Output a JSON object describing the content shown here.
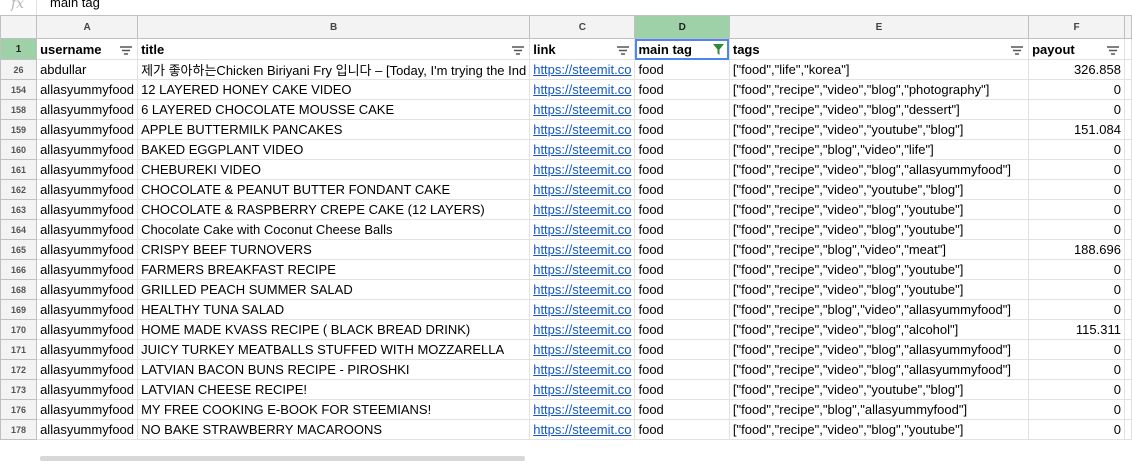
{
  "formula_bar": {
    "fx": "fx",
    "value": "main tag"
  },
  "columns": [
    "A",
    "B",
    "C",
    "D",
    "E",
    "F"
  ],
  "header": {
    "row": "1",
    "cells": [
      "username",
      "title",
      "link",
      "main tag",
      "tags",
      "payout"
    ]
  },
  "rows": [
    {
      "n": "26",
      "username": "abdullar",
      "title": "제가 좋아하는Chicken Biriyani Fry 입니다 – [Today, I'm trying the Ind",
      "link": "https://steemit.co",
      "main_tag": "food",
      "tags": "[\"food\",\"life\",\"korea\"]",
      "payout": "326.858"
    },
    {
      "n": "154",
      "username": "allasyummyfood",
      "title": "12 LAYERED HONEY CAKE VIDEO",
      "link": "https://steemit.co",
      "main_tag": "food",
      "tags": "[\"food\",\"recipe\",\"video\",\"blog\",\"photography\"]",
      "payout": "0"
    },
    {
      "n": "158",
      "username": "allasyummyfood",
      "title": "6 LAYERED CHOCOLATE MOUSSE CAKE",
      "link": "https://steemit.co",
      "main_tag": "food",
      "tags": "[\"food\",\"recipe\",\"video\",\"blog\",\"dessert\"]",
      "payout": "0"
    },
    {
      "n": "159",
      "username": "allasyummyfood",
      "title": "APPLE BUTTERMILK PANCAKES",
      "link": "https://steemit.co",
      "main_tag": "food",
      "tags": "[\"food\",\"recipe\",\"video\",\"youtube\",\"blog\"]",
      "payout": "151.084"
    },
    {
      "n": "160",
      "username": "allasyummyfood",
      "title": "BAKED EGGPLANT VIDEO",
      "link": "https://steemit.co",
      "main_tag": "food",
      "tags": "[\"food\",\"recipe\",\"blog\",\"video\",\"life\"]",
      "payout": "0"
    },
    {
      "n": "161",
      "username": "allasyummyfood",
      "title": "CHEBUREKI VIDEO",
      "link": "https://steemit.co",
      "main_tag": "food",
      "tags": "[\"food\",\"recipe\",\"video\",\"blog\",\"allasyummyfood\"]",
      "payout": "0"
    },
    {
      "n": "162",
      "username": "allasyummyfood",
      "title": "CHOCOLATE & PEANUT BUTTER FONDANT CAKE",
      "link": "https://steemit.co",
      "main_tag": "food",
      "tags": "[\"food\",\"recipe\",\"video\",\"youtube\",\"blog\"]",
      "payout": "0"
    },
    {
      "n": "163",
      "username": "allasyummyfood",
      "title": "CHOCOLATE & RASPBERRY CREPE CAKE (12 LAYERS)",
      "link": "https://steemit.co",
      "main_tag": "food",
      "tags": "[\"food\",\"recipe\",\"video\",\"blog\",\"youtube\"]",
      "payout": "0"
    },
    {
      "n": "164",
      "username": "allasyummyfood",
      "title": "Chocolate Cake with Coconut Cheese Balls",
      "link": "https://steemit.co",
      "main_tag": "food",
      "tags": "[\"food\",\"recipe\",\"video\",\"blog\",\"youtube\"]",
      "payout": "0"
    },
    {
      "n": "165",
      "username": "allasyummyfood",
      "title": "CRISPY BEEF TURNOVERS",
      "link": "https://steemit.co",
      "main_tag": "food",
      "tags": "[\"food\",\"recipe\",\"blog\",\"video\",\"meat\"]",
      "payout": "188.696"
    },
    {
      "n": "166",
      "username": "allasyummyfood",
      "title": "FARMERS BREAKFAST RECIPE",
      "link": "https://steemit.co",
      "main_tag": "food",
      "tags": "[\"food\",\"recipe\",\"video\",\"blog\",\"youtube\"]",
      "payout": "0"
    },
    {
      "n": "168",
      "username": "allasyummyfood",
      "title": "GRILLED PEACH SUMMER SALAD",
      "link": "https://steemit.co",
      "main_tag": "food",
      "tags": "[\"food\",\"recipe\",\"video\",\"blog\",\"youtube\"]",
      "payout": "0"
    },
    {
      "n": "169",
      "username": "allasyummyfood",
      "title": "HEALTHY TUNA SALAD",
      "link": "https://steemit.co",
      "main_tag": "food",
      "tags": "[\"food\",\"recipe\",\"blog\",\"video\",\"allasyummyfood\"]",
      "payout": "0"
    },
    {
      "n": "170",
      "username": "allasyummyfood",
      "title": "HOME MADE KVASS RECIPE ( BLACK BREAD DRINK)",
      "link": "https://steemit.co",
      "main_tag": "food",
      "tags": "[\"food\",\"recipe\",\"video\",\"blog\",\"alcohol\"]",
      "payout": "115.311"
    },
    {
      "n": "171",
      "username": "allasyummyfood",
      "title": "JUICY TURKEY MEATBALLS STUFFED WITH MOZZARELLA",
      "link": "https://steemit.co",
      "main_tag": "food",
      "tags": "[\"food\",\"recipe\",\"video\",\"blog\",\"allasyummyfood\"]",
      "payout": "0"
    },
    {
      "n": "172",
      "username": "allasyummyfood",
      "title": "LATVIAN BACON BUNS RECIPE - PIROSHKI",
      "link": "https://steemit.co",
      "main_tag": "food",
      "tags": "[\"food\",\"recipe\",\"video\",\"blog\",\"allasyummyfood\"]",
      "payout": "0"
    },
    {
      "n": "173",
      "username": "allasyummyfood",
      "title": "LATVIAN CHEESE RECIPE!",
      "link": "https://steemit.co",
      "main_tag": "food",
      "tags": "[\"food\",\"recipe\",\"video\",\"youtube\",\"blog\"]",
      "payout": "0"
    },
    {
      "n": "176",
      "username": "allasyummyfood",
      "title": "MY FREE COOKING E-BOOK FOR STEEMIANS!",
      "link": "https://steemit.co",
      "main_tag": "food",
      "tags": "[\"food\",\"recipe\",\"blog\",\"allasyummyfood\"]",
      "payout": "0"
    },
    {
      "n": "178",
      "username": "allasyummyfood",
      "title": "NO BAKE STRAWBERRY MACAROONS",
      "link": "https://steemit.co",
      "main_tag": "food",
      "tags": "[\"food\",\"recipe\",\"video\",\"blog\",\"youtube\"]",
      "payout": "0"
    }
  ],
  "colors": {
    "selected_header": "#9fd1a8",
    "active_filter": "#2e8b3a",
    "link": "#1155cc",
    "selection_border": "#4a88ed"
  }
}
